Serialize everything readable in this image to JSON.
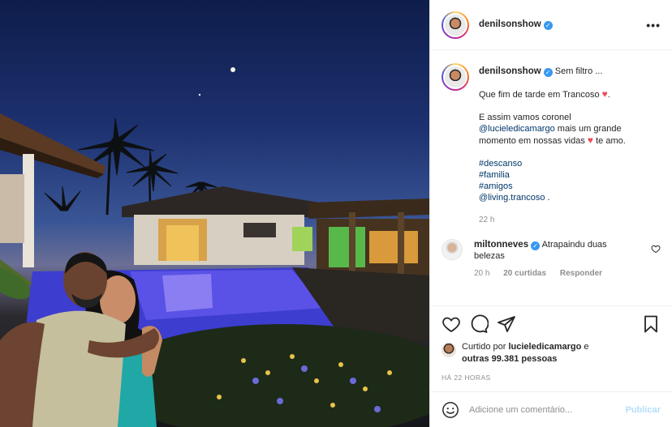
{
  "post": {
    "author": "denilsonshow",
    "more_icon": "more-horizontal-icon",
    "caption": {
      "first_line": "Sem filtro ...",
      "line2": "Que fim de tarde em Trancoso",
      "line3_a": "E assim vamos coronel",
      "line4_mention": "@lucieledicamargo",
      "line4_b": "mais um grande",
      "line5_a": "momento em nossas vidas",
      "line5_b": "te amo.",
      "hashtags": [
        "#descanso",
        "#familia",
        "#amigos"
      ],
      "location_mention": "@living.trancoso",
      "location_suffix": " .",
      "time": "22 h"
    },
    "comment": {
      "author": "miltonneves",
      "text_a": "Atrapaindu duas",
      "text_b": "belezas",
      "time": "20 h",
      "likes": "20 curtidas",
      "reply": "Responder"
    },
    "likes": {
      "prefix": "Curtido por",
      "user": "lucieledicamargo",
      "mid": "e",
      "others": "outras 99.381 pessoas"
    },
    "posted": "HÁ 22 HORAS",
    "add_comment": {
      "placeholder": "Adicione um comentário...",
      "publish": "Publicar"
    }
  }
}
